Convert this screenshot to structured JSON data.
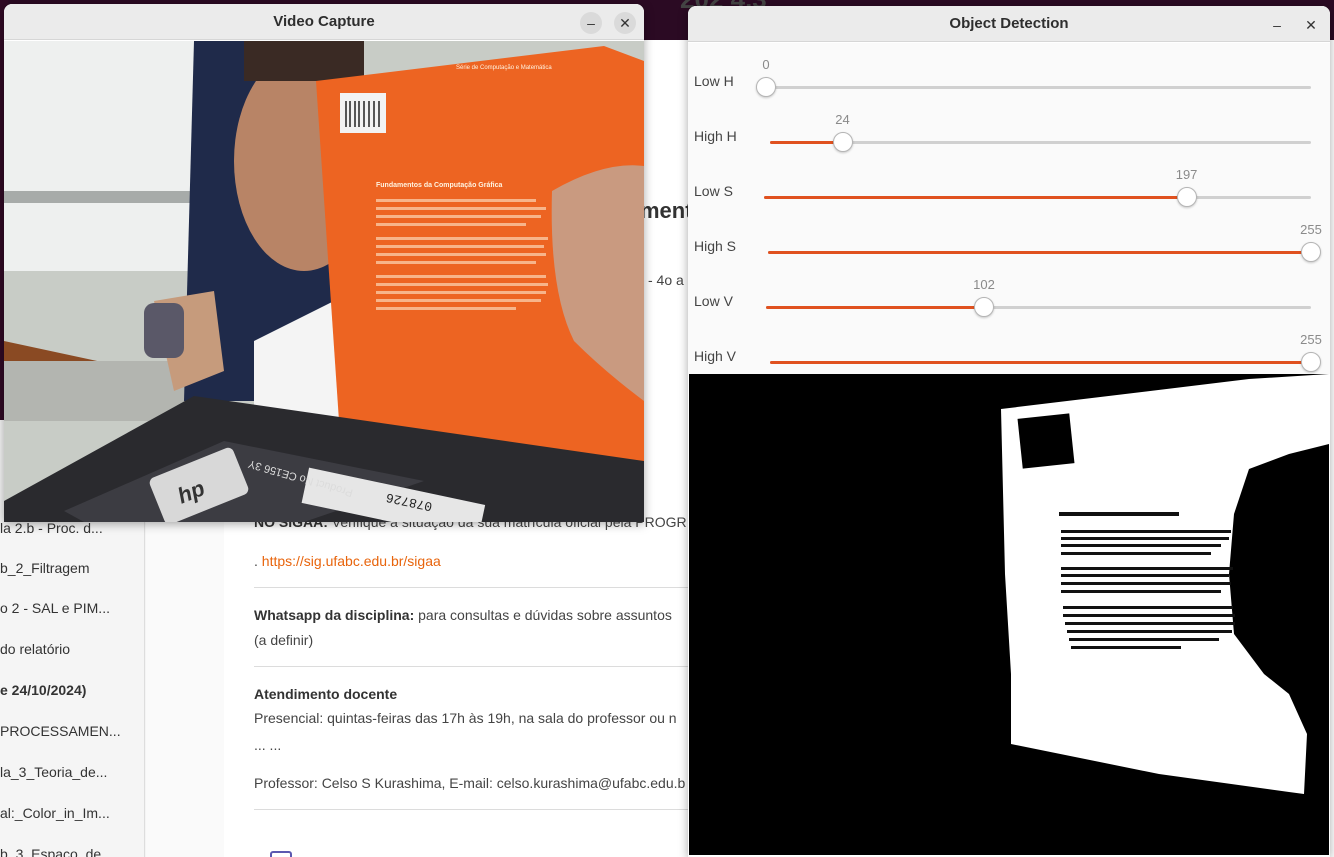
{
  "background_page": {
    "top_title": "202 4.3",
    "heading_partial": "ment",
    "inline_text_partial": "- 4o a",
    "sidebar_items": [
      "la 2.b - Proc. d...",
      "b_2_Filtragem",
      "o 2 - SAL e PIM...",
      "do relatório",
      "e 24/10/2024)",
      "PROCESSAMEN...",
      "la_3_Teoria_de...",
      "al:_Color_in_Im...",
      "b_3_Espaco_de..."
    ],
    "sigaa_label": "NO SIGAA:",
    "sigaa_text": " Verifique a situação da sua matrícula oficial pela PROGR",
    "sigaa_link_prefix": ". ",
    "sigaa_link": "https://sig.ufabc.edu.br/sigaa",
    "whatsapp_label": "Whatsapp da disciplina:",
    "whatsapp_text": " para consultas e dúvidas sobre assuntos",
    "whatsapp_note": "(a definir)",
    "atendimento_heading": "Atendimento docente",
    "atendimento_text": "Presencial: quintas-feiras das 17h às 19h, na sala do professor ou n",
    "atendimento_ellipsis": "... ...",
    "professor_text": "Professor: Celso S Kurashima, E-mail: celso.kurashima@ufabc.edu.b",
    "edge_letter": "d"
  },
  "video_window": {
    "title": "Video Capture",
    "minimize": "–",
    "close": "✕",
    "frame": {
      "book_title": "Fundamentos da Computação Gráfica",
      "book_series": "Série de Computação e Matemática",
      "laptop_label": "Product No CE156 3Y",
      "laptop_number": "078726",
      "brand": "hp"
    }
  },
  "detect_window": {
    "title": "Object Detection",
    "minimize": "–",
    "close": "✕",
    "sliders": [
      {
        "label": "Low H",
        "value": 0,
        "max": 179
      },
      {
        "label": "High H",
        "value": 24,
        "max": 179
      },
      {
        "label": "Low S",
        "value": 197,
        "max": 255
      },
      {
        "label": "High S",
        "value": 255,
        "max": 255
      },
      {
        "label": "Low V",
        "value": 102,
        "max": 255
      },
      {
        "label": "High V",
        "value": 255,
        "max": 255
      }
    ]
  }
}
